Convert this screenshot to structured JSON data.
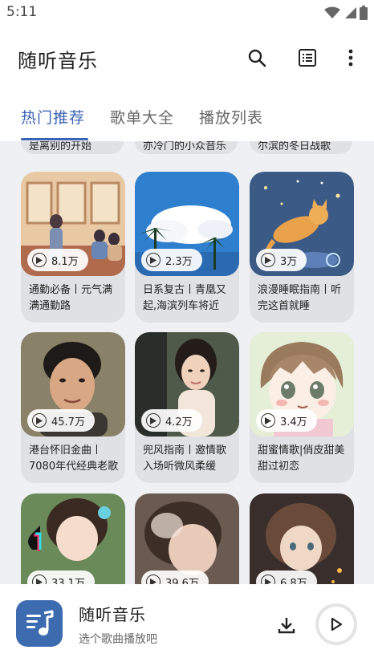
{
  "status": {
    "time": "5:11"
  },
  "app": {
    "title": "随听音乐"
  },
  "tabs": [
    {
      "label": "热门推荐",
      "active": true
    },
    {
      "label": "歌单大全",
      "active": false
    },
    {
      "label": "播放列表",
      "active": false
    }
  ],
  "partial_row": [
    {
      "name": "是离别的开始"
    },
    {
      "name": "亦冷门的小众音乐"
    },
    {
      "name": "尔滨的冬日战歌"
    }
  ],
  "playlists": [
    {
      "count": "8.1万",
      "name": "通勤必备丨元气满满通勤路"
    },
    {
      "count": "2.3万",
      "name": "日系复古丨青凰又起,海滨列车将近"
    },
    {
      "count": "3万",
      "name": "浪漫睡眠指南丨听完这首就睡"
    },
    {
      "count": "45.7万",
      "name": "港台怀旧金曲丨7080年代经典老歌"
    },
    {
      "count": "4.2万",
      "name": "兜风指南丨邀情歌入场听微风柔缓"
    },
    {
      "count": "3.4万",
      "name": "甜蜜情歌|俏皮甜美甜过初恋"
    },
    {
      "count": "33.1万",
      "name": ""
    },
    {
      "count": "39.6万",
      "name": ""
    },
    {
      "count": "6.8万",
      "name": ""
    }
  ],
  "player": {
    "title": "随听音乐",
    "subtitle": "选个歌曲播放吧"
  },
  "colors": {
    "accent": "#3b63b3",
    "logo_bg": "#3d6bb0",
    "content_bg": "#eef0f3",
    "card_bg": "#dfe1e5"
  },
  "icons": [
    "wifi-icon",
    "signal-icon",
    "battery-icon",
    "search-icon",
    "list-icon",
    "more-vert-icon",
    "play-circle-icon",
    "music-note-icon",
    "download-icon",
    "play-icon"
  ]
}
